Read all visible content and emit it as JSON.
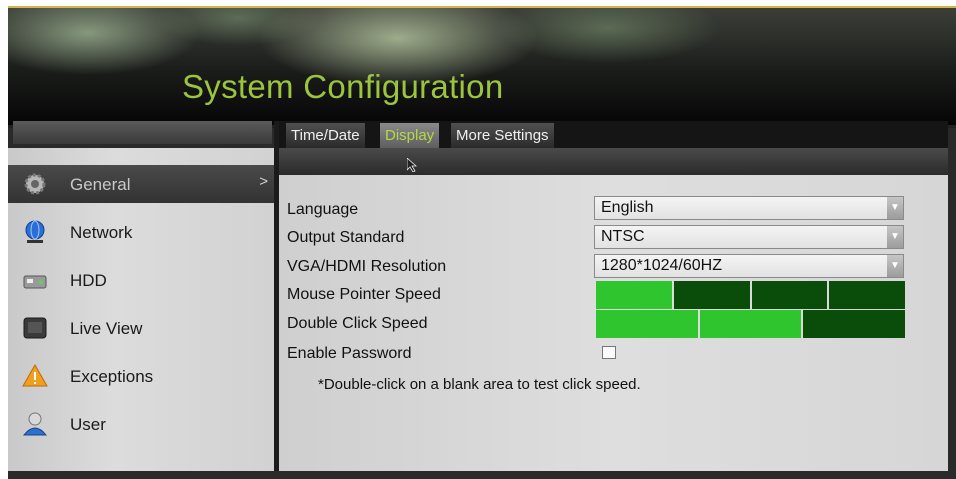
{
  "window": {
    "title": "System Configuration"
  },
  "sidebar": {
    "items": [
      {
        "label": "General",
        "icon": "gear-icon",
        "active": true,
        "arrow": ">"
      },
      {
        "label": "Network",
        "icon": "network-globe-icon",
        "active": false
      },
      {
        "label": "HDD",
        "icon": "hard-disk-icon",
        "active": false
      },
      {
        "label": "Live View",
        "icon": "monitor-icon",
        "active": false
      },
      {
        "label": "Exceptions",
        "icon": "warning-icon",
        "active": false
      },
      {
        "label": "User",
        "icon": "user-icon",
        "active": false
      }
    ]
  },
  "tabs": [
    {
      "label": "Time/Date",
      "active": false
    },
    {
      "label": "Display",
      "active": true
    },
    {
      "label": "More Settings",
      "active": false
    }
  ],
  "settings": {
    "language": {
      "label": "Language",
      "value": "English"
    },
    "output_standard": {
      "label": "Output Standard",
      "value": "NTSC"
    },
    "resolution": {
      "label": "VGA/HDMI Resolution",
      "value": "1280*1024/60HZ"
    },
    "mouse_speed": {
      "label": "Mouse Pointer Speed",
      "level": 1,
      "max": 4
    },
    "double_click": {
      "label": "Double Click Speed",
      "level": 2,
      "max": 3
    },
    "password": {
      "label": "Enable Password",
      "checked": false
    }
  },
  "note": "*Double-click on a blank area to test click speed.",
  "colors": {
    "accent": "#9bc53d",
    "speed_on": "#2ec52e",
    "speed_off": "#0a4d0a"
  }
}
